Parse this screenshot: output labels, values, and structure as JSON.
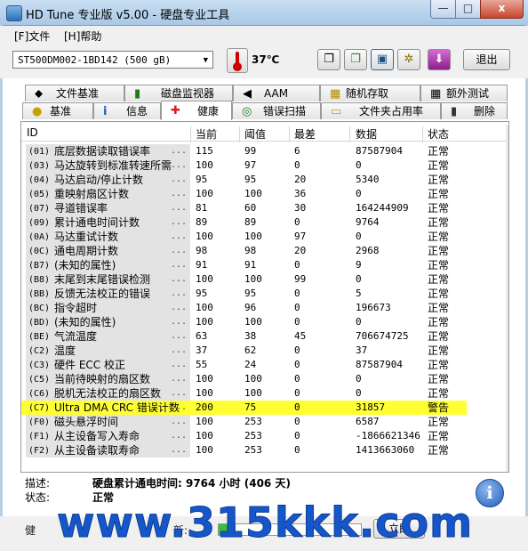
{
  "window": {
    "title": "HD Tune 专业版 v5.00 - 硬盘专业工具",
    "min": "—",
    "max": "□",
    "close": "x"
  },
  "menu": {
    "file": "[F]文件",
    "help": "[H]帮助"
  },
  "toolbar": {
    "drive": "ST500DM002-1BD142 (500 gB)",
    "temperature": "37℃",
    "exit": "退出"
  },
  "tabs_top": [
    {
      "label": "文件基准",
      "icon": "file-benchmark-icon",
      "glyph": "⬥"
    },
    {
      "label": "磁盘监视器",
      "icon": "disk-monitor-icon",
      "glyph": "▮"
    },
    {
      "label": "AAM",
      "icon": "speaker-icon",
      "glyph": "◀"
    },
    {
      "label": "随机存取",
      "icon": "random-access-icon",
      "glyph": "▦"
    },
    {
      "label": "额外测试",
      "icon": "extra-tests-icon",
      "glyph": "▦"
    }
  ],
  "tabs_bottom": [
    {
      "label": "基准",
      "icon": "benchmark-icon",
      "glyph": "●"
    },
    {
      "label": "信息",
      "icon": "info-icon",
      "glyph": "i"
    },
    {
      "label": "健康",
      "icon": "health-cross-icon",
      "glyph": "✚"
    },
    {
      "label": "错误扫描",
      "icon": "error-scan-icon",
      "glyph": "◎"
    },
    {
      "label": "文件夹占用率",
      "icon": "folder-usage-icon",
      "glyph": "▭"
    },
    {
      "label": "删除",
      "icon": "trash-icon",
      "glyph": "▮"
    }
  ],
  "columns": [
    "ID",
    "当前",
    "阈值",
    "最差",
    "数据",
    "状态"
  ],
  "rows": [
    {
      "code": "(01)",
      "name": "底层数据读取错误率",
      "current": "115",
      "threshold": "99",
      "worst": "6",
      "data": "87587904",
      "status": "正常"
    },
    {
      "code": "(03)",
      "name": "马达旋转到标准转速所需",
      "current": "100",
      "threshold": "97",
      "worst": "0",
      "data": "0",
      "status": "正常"
    },
    {
      "code": "(04)",
      "name": "马达启动/停止计数",
      "current": "95",
      "threshold": "95",
      "worst": "20",
      "data": "5340",
      "status": "正常"
    },
    {
      "code": "(05)",
      "name": "重映射扇区计数",
      "current": "100",
      "threshold": "100",
      "worst": "36",
      "data": "0",
      "status": "正常"
    },
    {
      "code": "(07)",
      "name": "寻道错误率",
      "current": "81",
      "threshold": "60",
      "worst": "30",
      "data": "164244909",
      "status": "正常"
    },
    {
      "code": "(09)",
      "name": "累计通电时间计数",
      "current": "89",
      "threshold": "89",
      "worst": "0",
      "data": "9764",
      "status": "正常"
    },
    {
      "code": "(0A)",
      "name": "马达重试计数",
      "current": "100",
      "threshold": "100",
      "worst": "97",
      "data": "0",
      "status": "正常"
    },
    {
      "code": "(0C)",
      "name": "通电周期计数",
      "current": "98",
      "threshold": "98",
      "worst": "20",
      "data": "2968",
      "status": "正常"
    },
    {
      "code": "(B7)",
      "name": "(未知的属性)",
      "current": "91",
      "threshold": "91",
      "worst": "0",
      "data": "9",
      "status": "正常"
    },
    {
      "code": "(B8)",
      "name": "末尾到末尾错误检测",
      "current": "100",
      "threshold": "100",
      "worst": "99",
      "data": "0",
      "status": "正常"
    },
    {
      "code": "(BB)",
      "name": "反馈无法校正的错误",
      "current": "95",
      "threshold": "95",
      "worst": "0",
      "data": "5",
      "status": "正常"
    },
    {
      "code": "(BC)",
      "name": "指令超时",
      "current": "100",
      "threshold": "96",
      "worst": "0",
      "data": "196673",
      "status": "正常"
    },
    {
      "code": "(BD)",
      "name": "(未知的属性)",
      "current": "100",
      "threshold": "100",
      "worst": "0",
      "data": "0",
      "status": "正常"
    },
    {
      "code": "(BE)",
      "name": "气流温度",
      "current": "63",
      "threshold": "38",
      "worst": "45",
      "data": "706674725",
      "status": "正常"
    },
    {
      "code": "(C2)",
      "name": "温度",
      "current": "37",
      "threshold": "62",
      "worst": "0",
      "data": "37",
      "status": "正常"
    },
    {
      "code": "(C3)",
      "name": "硬件 ECC 校正",
      "current": "55",
      "threshold": "24",
      "worst": "0",
      "data": "87587904",
      "status": "正常"
    },
    {
      "code": "(C5)",
      "name": "当前待映射的扇区数",
      "current": "100",
      "threshold": "100",
      "worst": "0",
      "data": "0",
      "status": "正常"
    },
    {
      "code": "(C6)",
      "name": "脱机无法校正的扇区数",
      "current": "100",
      "threshold": "100",
      "worst": "0",
      "data": "0",
      "status": "正常"
    },
    {
      "code": "(C7)",
      "name": "Ultra DMA CRC 错误计数",
      "current": "200",
      "threshold": "75",
      "worst": "0",
      "data": "31857",
      "status": "警告",
      "warn": true
    },
    {
      "code": "(F0)",
      "name": "磁头悬浮时间",
      "current": "100",
      "threshold": "253",
      "worst": "0",
      "data": "6587",
      "status": "正常"
    },
    {
      "code": "(F1)",
      "name": "从主设备写入寿命",
      "current": "100",
      "threshold": "253",
      "worst": "0",
      "data": "-1866621346",
      "status": "正常"
    },
    {
      "code": "(F2)",
      "name": "从主设备读取寿命",
      "current": "100",
      "threshold": "253",
      "worst": "0",
      "data": "1413663060",
      "status": "正常"
    }
  ],
  "dots": "...",
  "detail": {
    "desc_label": "描述:",
    "desc_value": "硬盘累计通电时间: 9764 小时 (406 天)",
    "status_label": "状态:",
    "status_value": "正常"
  },
  "bottom": {
    "left_label": "健",
    "mid_label": "新:",
    "button": "立即",
    "progress": 0.12
  },
  "watermark": "www.315kkk.com",
  "colors": {
    "warn_highlight": "#ffff33",
    "accent": "#1557c9"
  }
}
